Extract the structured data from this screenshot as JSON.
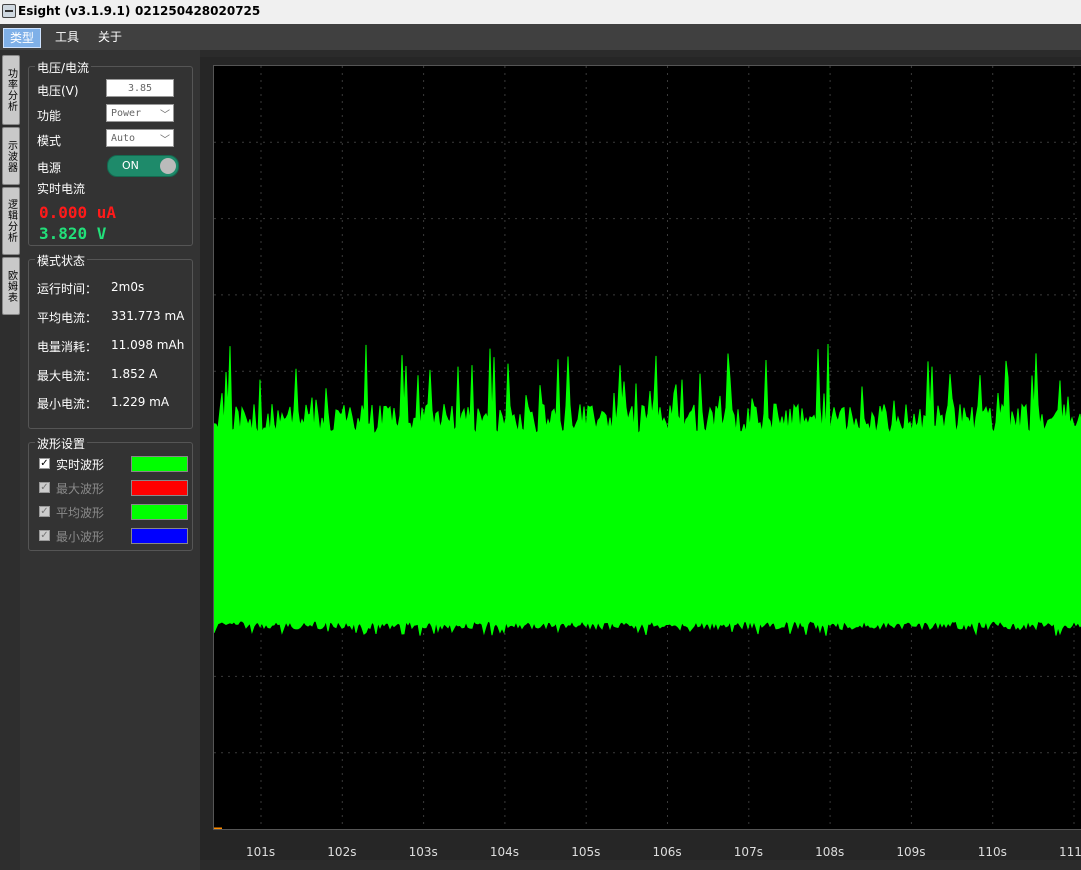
{
  "window": {
    "title": "Esight (v3.1.9.1)",
    "serial": "021250428020725"
  },
  "menu": {
    "items": [
      "类型",
      "工具",
      "关于"
    ]
  },
  "side_tabs": [
    "功率分析",
    "示波器",
    "逻辑分析",
    "欧姆表"
  ],
  "power_group": {
    "title": "电压/电流",
    "voltage_label": "电压(V)",
    "voltage_value": "3.85",
    "function_label": "功能",
    "function_value": "Power",
    "mode_label": "模式",
    "mode_value": "Auto",
    "power_label": "电源",
    "power_state": "ON",
    "realtime_label": "实时电流",
    "current_reading": "0.000 uA",
    "voltage_reading": "3.820 V"
  },
  "mode_status": {
    "title": "模式状态",
    "rows": [
      {
        "label": "运行时间：",
        "value": "2m0s"
      },
      {
        "label": "平均电流：",
        "value": "331.773 mA"
      },
      {
        "label": "电量消耗：",
        "value": "11.098 mAh"
      },
      {
        "label": "最大电流：",
        "value": "1.852 A"
      },
      {
        "label": "最小电流：",
        "value": "1.229 mA"
      }
    ]
  },
  "waveform_settings": {
    "title": "波形设置",
    "items": [
      {
        "label": "实时波形",
        "checked": true,
        "enabled": true,
        "color": "#00ff00"
      },
      {
        "label": "最大波形",
        "checked": true,
        "enabled": false,
        "color": "#ff0000"
      },
      {
        "label": "平均波形",
        "checked": true,
        "enabled": false,
        "color": "#00ff00"
      },
      {
        "label": "最小波形",
        "checked": true,
        "enabled": false,
        "color": "#0000ff"
      }
    ]
  },
  "plot": {
    "x_ticks": [
      "101s",
      "102s",
      "103s",
      "104s",
      "105s",
      "106s",
      "107s",
      "108s",
      "109s",
      "110s",
      "111"
    ],
    "trace_color": "#00ff00"
  }
}
